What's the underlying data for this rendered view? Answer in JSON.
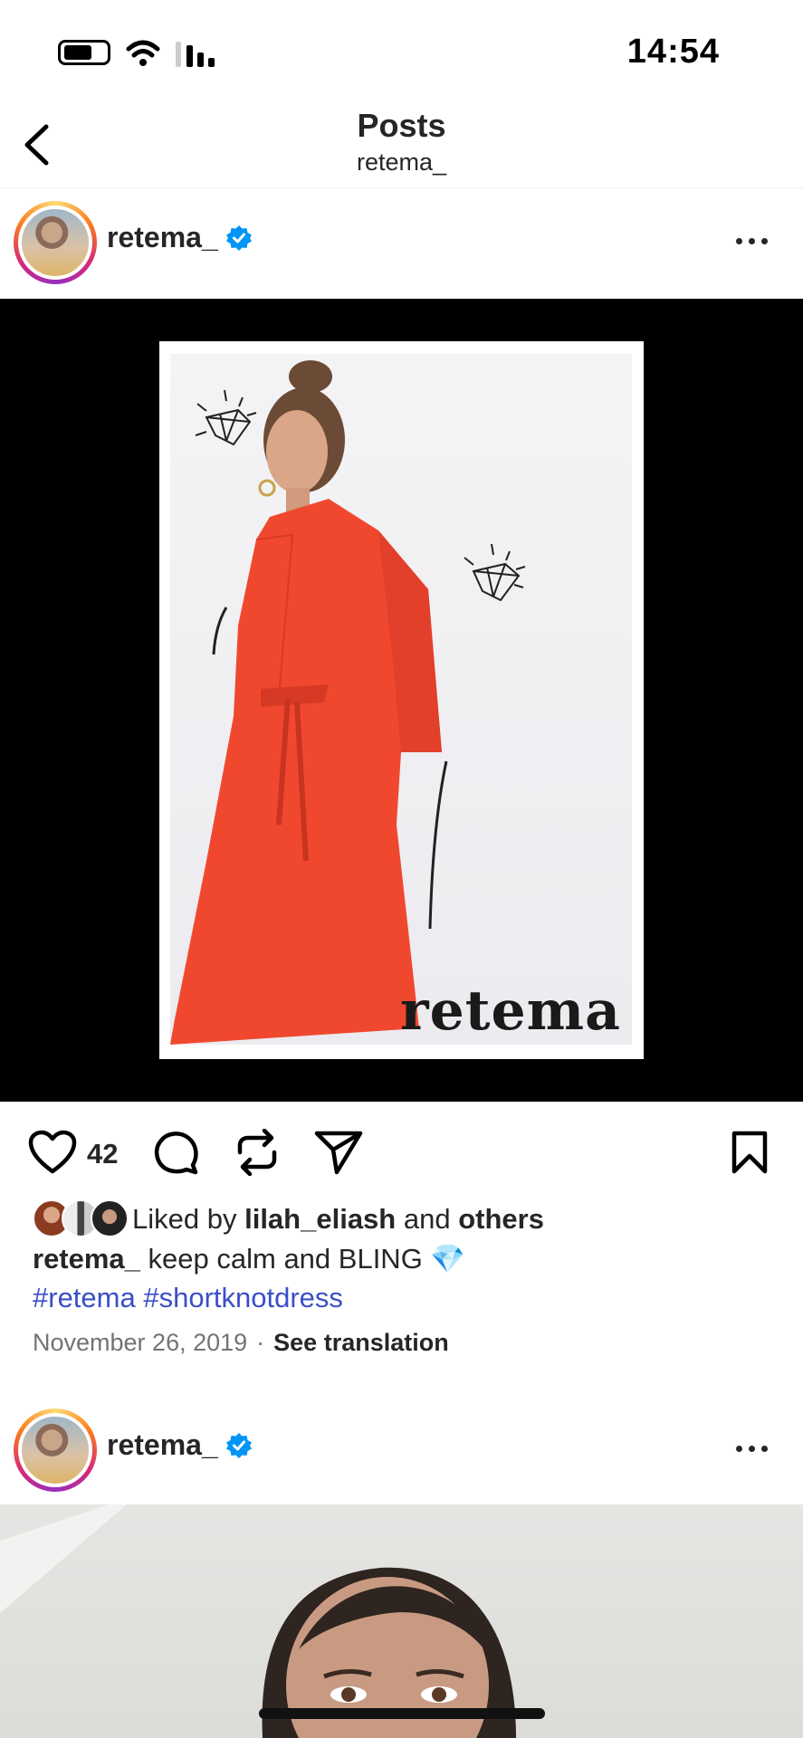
{
  "status_bar": {
    "time": "14:54"
  },
  "header": {
    "title": "Posts",
    "subtitle": "retema_"
  },
  "posts": [
    {
      "username": "retema_",
      "image_logo": "retema",
      "like_count": "42",
      "likes": {
        "prefix": "Liked by",
        "user": "lilah_eliash",
        "connector": "and",
        "others": "others"
      },
      "caption": {
        "username": "retema_",
        "text": "keep calm and BLING 💎"
      },
      "hashtags": [
        "#retema",
        "#shortknotdress"
      ],
      "date": "November 26, 2019",
      "separator": "·",
      "see_translation": "See translation"
    },
    {
      "username": "retema_"
    }
  ],
  "colors": {
    "verified": "#0095f6",
    "hashtag": "#3b4fc7",
    "dress": "#f0482f"
  },
  "icons": [
    "back-icon",
    "verified-icon",
    "more-icon",
    "heart-icon",
    "comment-icon",
    "repost-icon",
    "share-icon",
    "bookmark-icon"
  ]
}
